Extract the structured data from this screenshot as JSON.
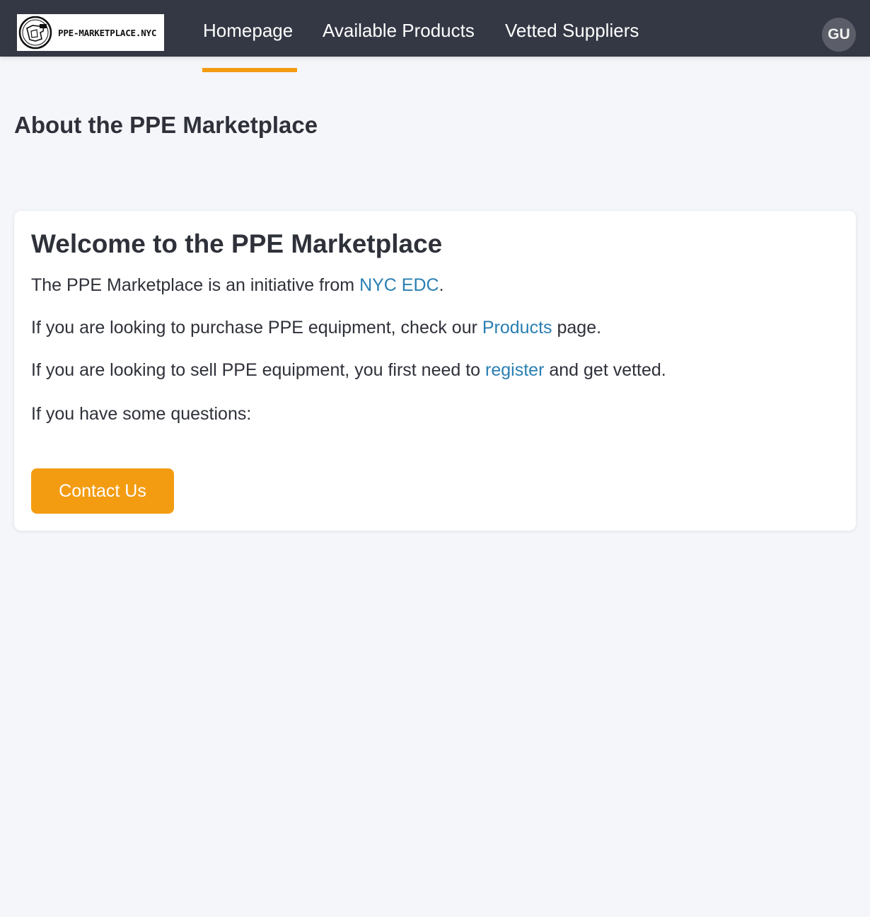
{
  "header": {
    "logo_text": "PPE-MARKETPLACE.NYC",
    "nav": {
      "home": "Homepage",
      "products": "Available Products",
      "suppliers": "Vetted Suppliers"
    },
    "active_tab": "home",
    "avatar_initials": "GU"
  },
  "colors": {
    "header_bg": "#343844",
    "accent": "#f39c12",
    "link": "#2a7fb3",
    "page_bg": "#f5f6fa"
  },
  "page": {
    "title": "About the PPE Marketplace"
  },
  "card": {
    "title": "Welcome to the PPE Marketplace",
    "p1": {
      "before": "The PPE Marketplace is an initiative from ",
      "link": "NYC EDC",
      "after": "."
    },
    "p2": {
      "before": "If you are looking to purchase PPE equipment, check our ",
      "link": "Products",
      "after": " page."
    },
    "p3": {
      "before": "If you are looking to sell PPE equipment, you first need to ",
      "link": "register",
      "after": " and get vetted."
    },
    "p4": "If you have some questions:",
    "contact_button": "Contact Us"
  }
}
